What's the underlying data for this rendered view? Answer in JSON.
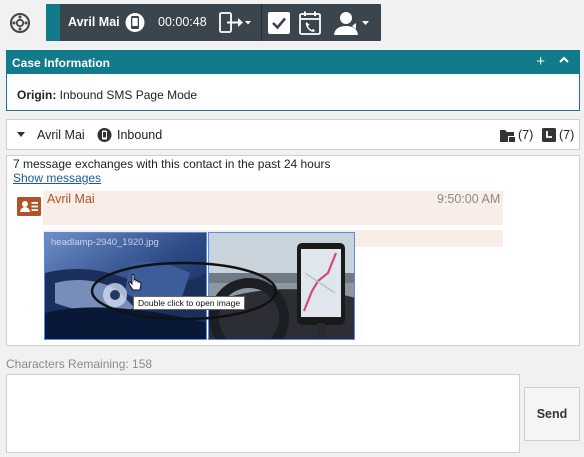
{
  "callbar": {
    "contact_name": "Avril Mai",
    "timer": "00:00:48",
    "icons": {
      "settings": "gear-icon",
      "device": "mobile-sms-icon",
      "transfer": "transfer-icon",
      "done": "checkmark-icon",
      "schedule": "schedule-callback-icon",
      "consult": "consult-agent-icon"
    },
    "colors": {
      "bar": "#3a454d",
      "accent": "#117a8b"
    }
  },
  "case_info": {
    "title": "Case Information",
    "origin_label": "Origin:",
    "origin_value": "Inbound SMS Page Mode",
    "header_color": "#117a8b"
  },
  "interaction": {
    "contact_name": "Avril Mai",
    "direction": "Inbound",
    "cases_count": "(7)",
    "history_count": "(7)"
  },
  "transcript": {
    "exchange_summary": "7 message exchanges with this contact in the past 24 hours",
    "show_messages": "Show messages",
    "message": {
      "sender": "Avril Mai",
      "time": "9:50:00 AM",
      "image_caption": "headlamp-2940_1920.jpg",
      "tooltip": "Double click to open image"
    }
  },
  "composer": {
    "characters_remaining": "Characters Remaining: 158",
    "text": "",
    "send_label": "Send"
  }
}
